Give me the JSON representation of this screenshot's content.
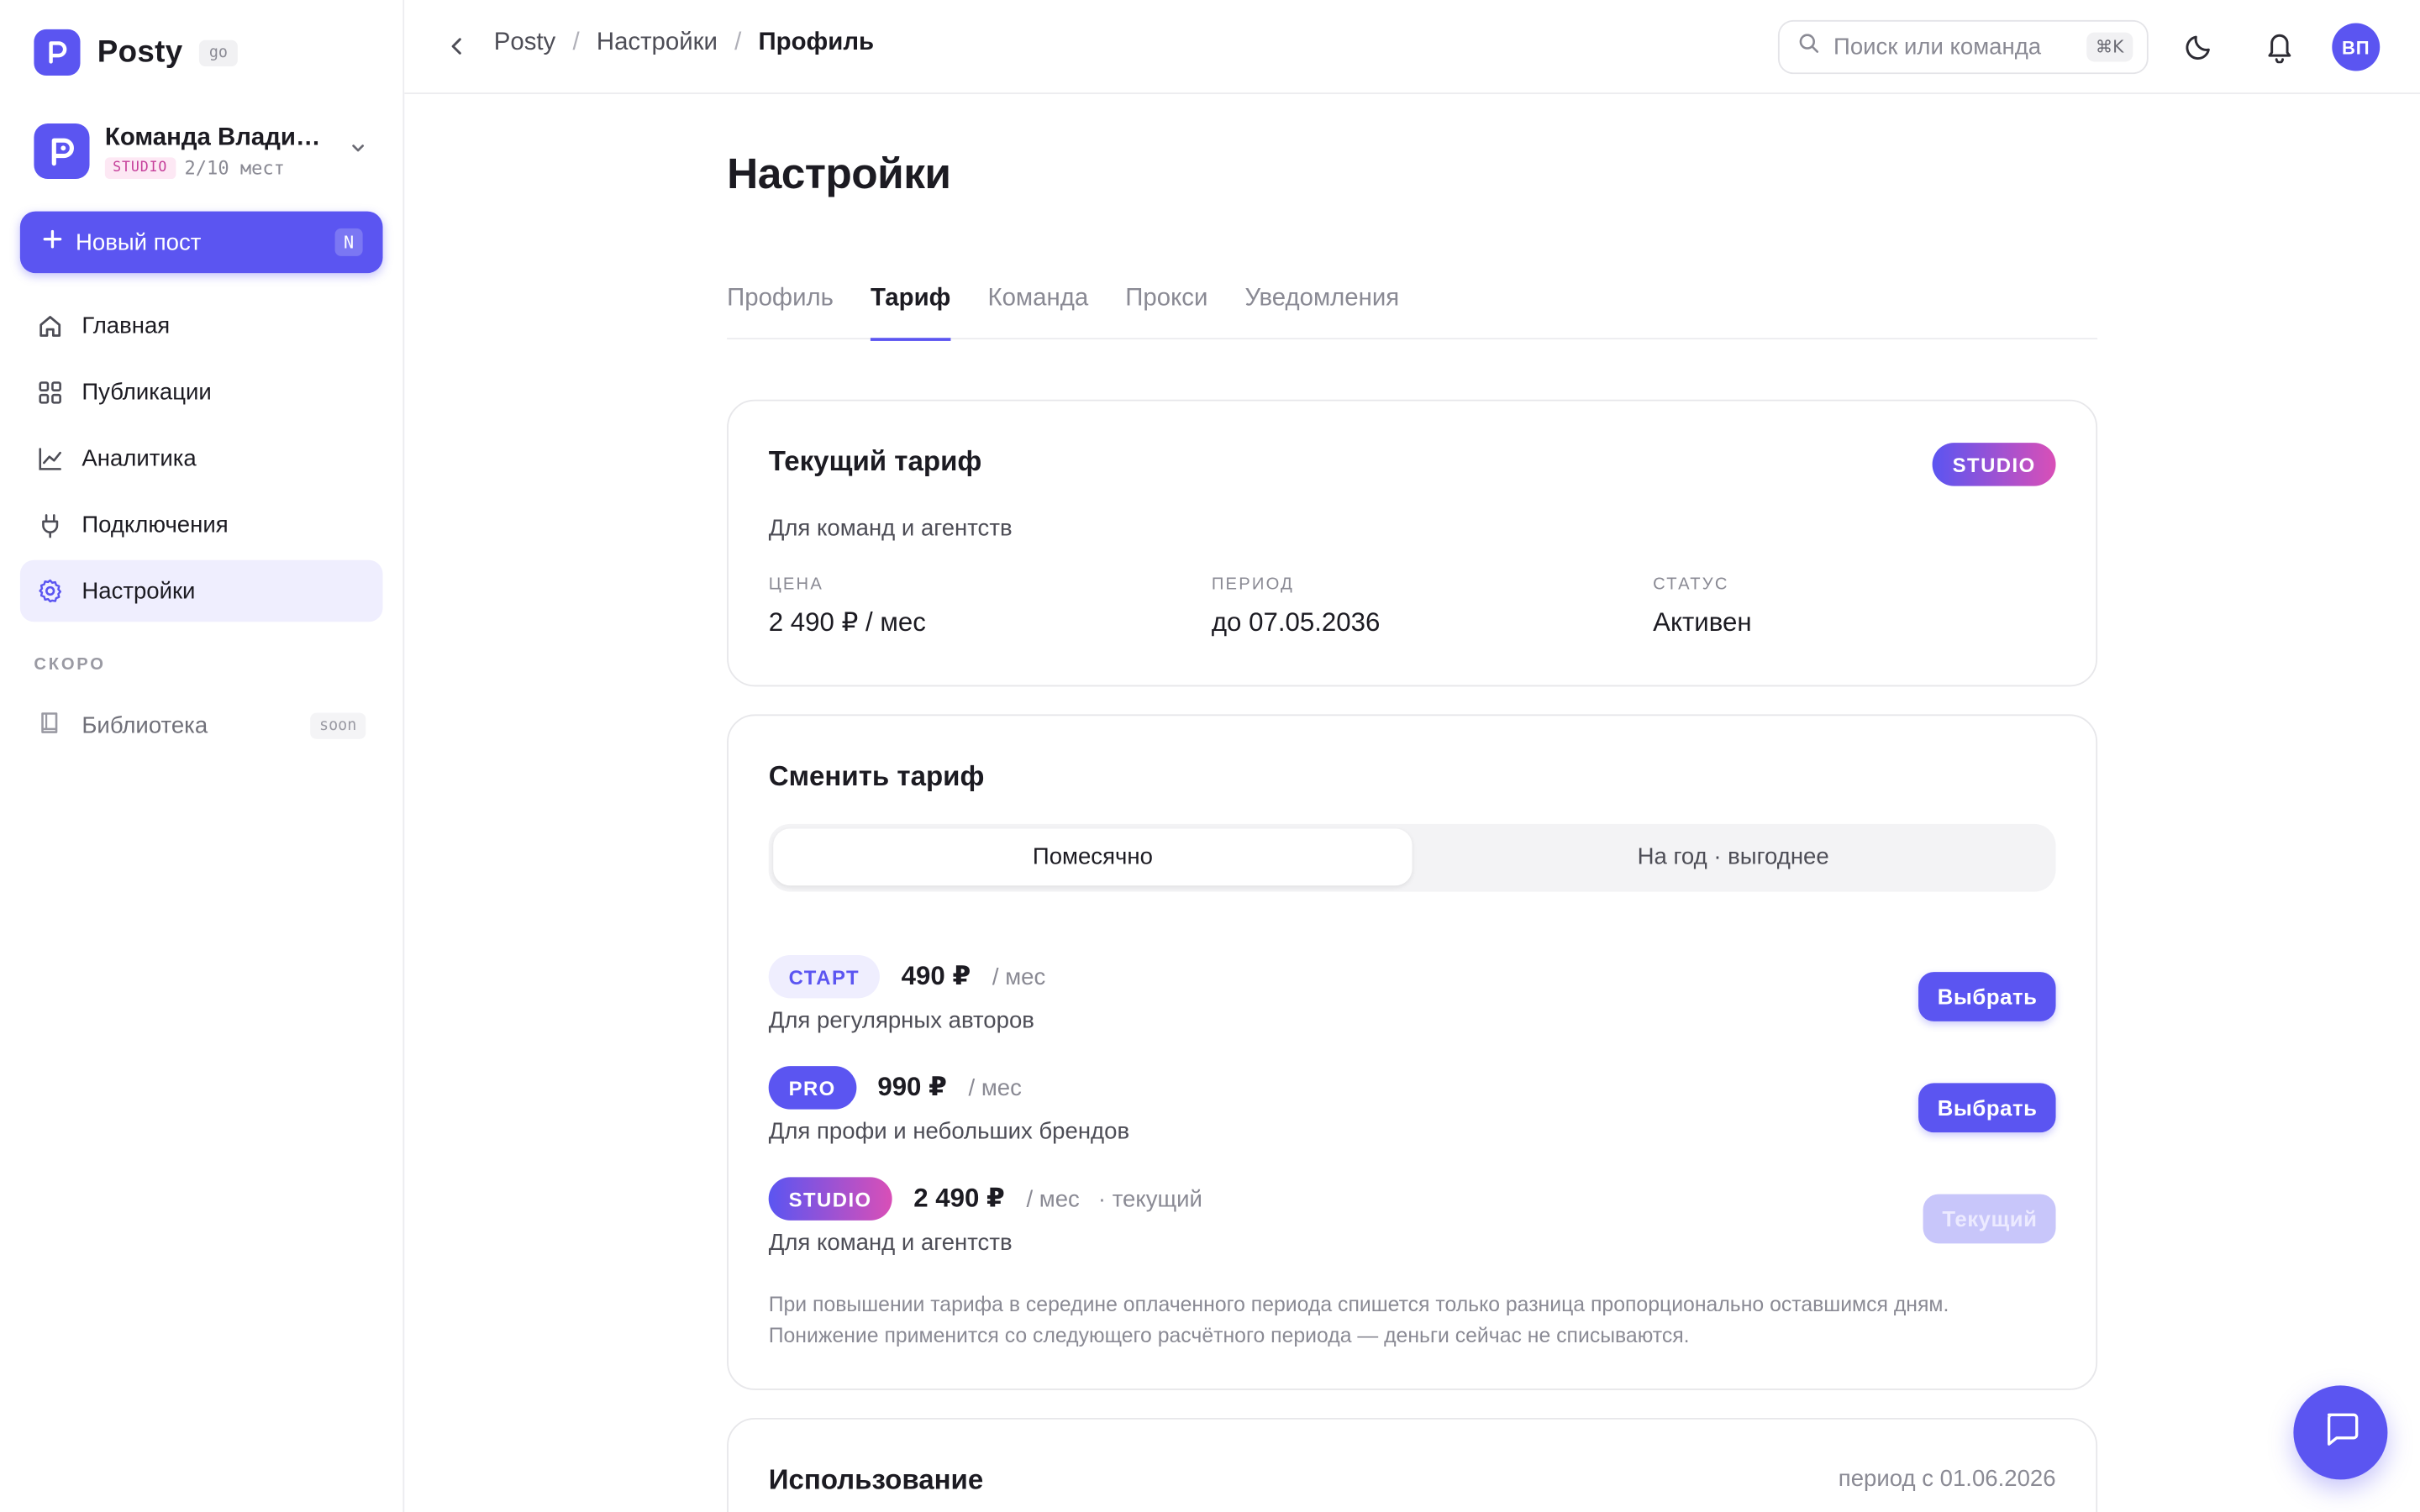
{
  "brand": {
    "name": "Posty",
    "chip": "go"
  },
  "team": {
    "name": "Команда Владимира",
    "plan": "STUDIO",
    "seats": "2/10 мест"
  },
  "new_post": {
    "label": "Новый пост",
    "shortcut": "N"
  },
  "nav": [
    {
      "label": "Главная",
      "icon": "home-icon"
    },
    {
      "label": "Публикации",
      "icon": "grid-icon"
    },
    {
      "label": "Аналитика",
      "icon": "chart-icon"
    },
    {
      "label": "Подключения",
      "icon": "plug-icon"
    },
    {
      "label": "Настройки",
      "icon": "gear-icon"
    }
  ],
  "soon": {
    "header": "СКОРО",
    "item_label": "Библиотека",
    "chip": "soon"
  },
  "breadcrumb": [
    "Posty",
    "Настройки",
    "Профиль"
  ],
  "search": {
    "placeholder": "Поиск или команда",
    "shortcut": "⌘K"
  },
  "user": {
    "initials": "ВП"
  },
  "page": {
    "title": "Настройки"
  },
  "tabs": [
    "Профиль",
    "Тариф",
    "Команда",
    "Прокси",
    "Уведомления"
  ],
  "current_plan": {
    "title": "Текущий тариф",
    "badge": "STUDIO",
    "subtitle": "Для команд и агентств",
    "stats": [
      {
        "key": "ЦЕНА",
        "value": "2 490 ₽ / мес"
      },
      {
        "key": "ПЕРИОД",
        "value": "до 07.05.2036"
      },
      {
        "key": "СТАТУС",
        "value": "Активен"
      }
    ]
  },
  "change_plan": {
    "title": "Сменить тариф",
    "billing": {
      "monthly": "Помесячно",
      "yearly": "На год · выгоднее",
      "selected": "Помесячно"
    },
    "plans": [
      {
        "badge": "СТАРТ",
        "price": "490 ₽",
        "per": "/ мес",
        "tag": "",
        "desc": "Для регулярных авторов",
        "button": "Выбрать"
      },
      {
        "badge": "PRO",
        "price": "990 ₽",
        "per": "/ мес",
        "tag": "",
        "desc": "Для профи и небольших брендов",
        "button": "Выбрать"
      },
      {
        "badge": "STUDIO",
        "price": "2 490 ₽",
        "per": "/ мес",
        "tag": "· текущий",
        "desc": "Для команд и агентств",
        "button": "Текущий"
      }
    ],
    "note_line1": "При повышении тарифа в середине оплаченного периода спишется только разница пропорционально оставшимся дням.",
    "note_line2": "Понижение применится со следующего расчётного периода — деньги сейчас не списываются."
  },
  "usage": {
    "title": "Использование",
    "period": "период с 01.06.2026"
  },
  "colors": {
    "accent": "#5b55f1",
    "studio_gradient_end": "#d94fb7",
    "text": "#1c1b22",
    "muted": "#8a8a94"
  }
}
